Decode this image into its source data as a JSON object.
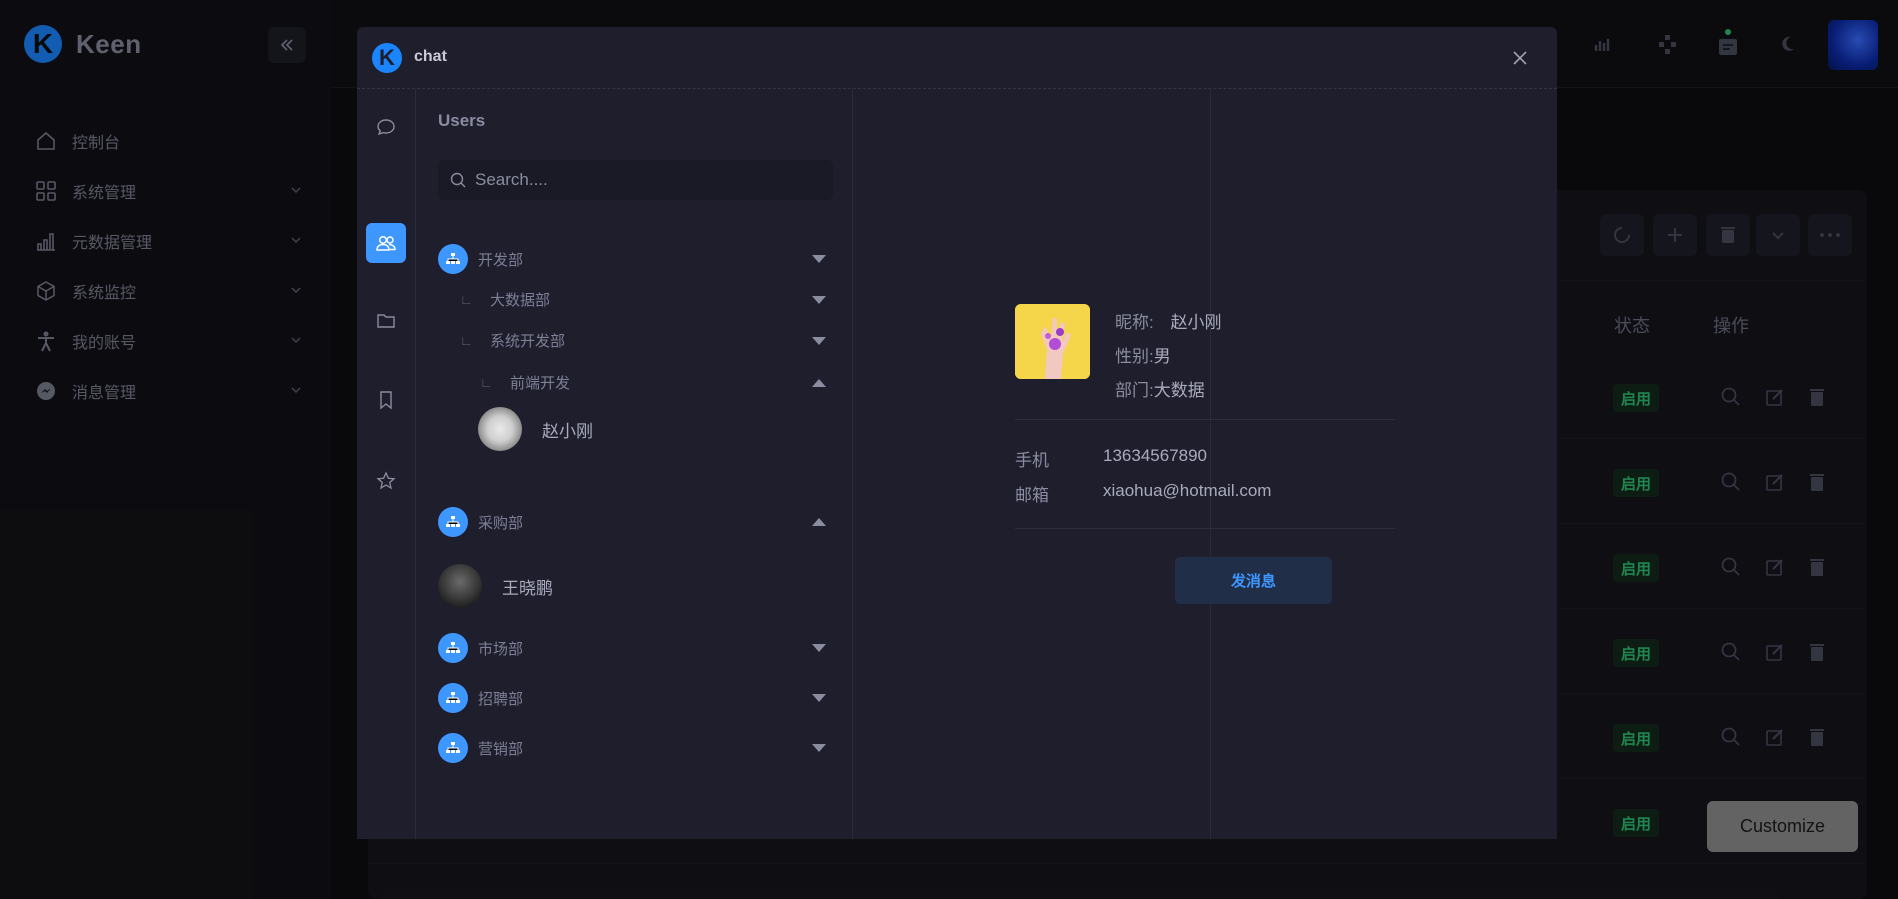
{
  "app": {
    "brand": "Keen",
    "brand_letter": "K",
    "nav": [
      {
        "label": "控制台",
        "icon": "home-icon",
        "has_chevron": false
      },
      {
        "label": "系统管理",
        "icon": "grid-icon",
        "has_chevron": true
      },
      {
        "label": "元数据管理",
        "icon": "bar-chart-icon",
        "has_chevron": true
      },
      {
        "label": "系统监控",
        "icon": "cube-icon",
        "has_chevron": true
      },
      {
        "label": "我的账号",
        "icon": "person-icon",
        "has_chevron": true
      },
      {
        "label": "消息管理",
        "icon": "messenger-icon",
        "has_chevron": true
      }
    ]
  },
  "table": {
    "col_status": "状态",
    "col_actions": "操作",
    "status_label": "启用",
    "rows": 6
  },
  "customize_label": "Customize",
  "chat": {
    "title": "chat",
    "logo_letter": "K",
    "users_title": "Users",
    "search_placeholder": "Search....",
    "tree": {
      "dept_dev": "开发部",
      "sub_bigdata": "大数据部",
      "sub_sysdev": "系统开发部",
      "sub_frontend": "前端开发",
      "user_zhao": "赵小刚",
      "dept_purchase": "采购部",
      "user_wang": "王晓鹏",
      "dept_market": "市场部",
      "dept_hiring": "招聘部",
      "dept_sales": "营销部"
    },
    "profile": {
      "nickname_label": "昵称:",
      "nickname": "赵小刚",
      "gender_label": "性别:",
      "gender": "男",
      "dept_label": "部门:",
      "dept": "大数据",
      "phone_label": "手机",
      "phone": "13634567890",
      "email_label": "邮箱",
      "email": "xiaohua@hotmail.com",
      "send_label": "发消息"
    }
  },
  "colors": {
    "accent": "#3e97ff",
    "modal_bg": "#1e1e2d",
    "status_green": "#2fbf71"
  }
}
